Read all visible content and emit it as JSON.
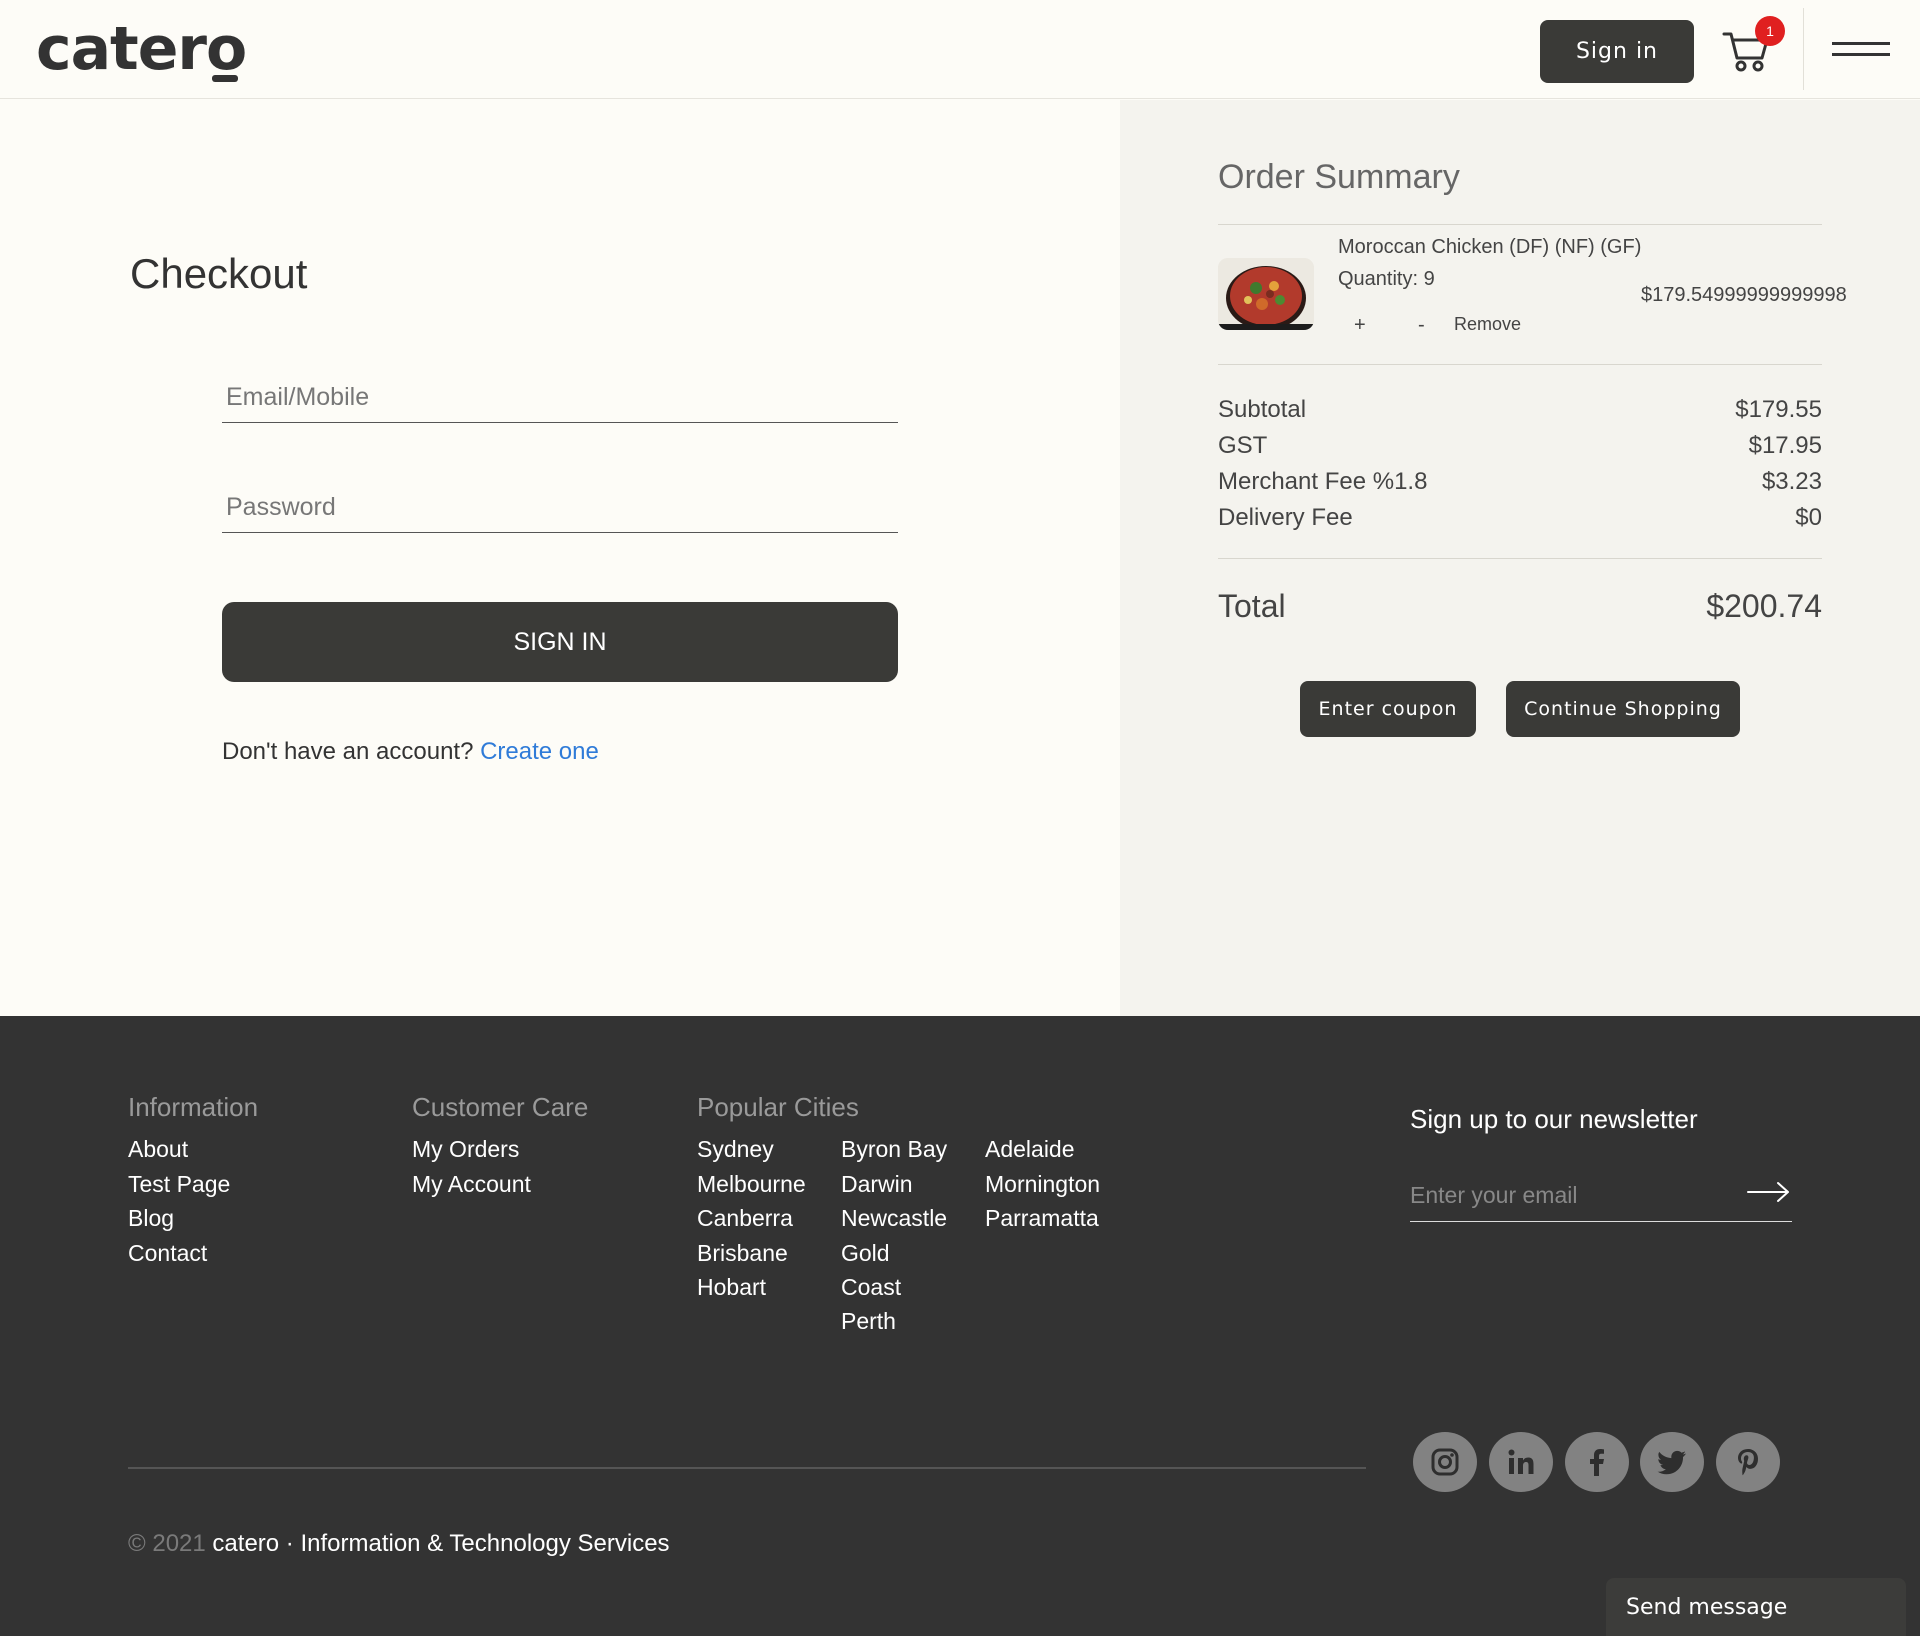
{
  "header": {
    "logo": "catero",
    "sign_in": "Sign in",
    "cart_count": "1",
    "cart_icon": "cart-icon",
    "menu_icon": "hamburger-menu-icon"
  },
  "checkout": {
    "title": "Checkout",
    "email_placeholder": "Email/Mobile",
    "password_placeholder": "Password",
    "sign_in_button": "SIGN IN",
    "no_account_text": "Don't have an account? ",
    "create_link": "Create one"
  },
  "summary": {
    "title": "Order Summary",
    "item": {
      "name": "Moroccan Chicken (DF) (NF) (GF)",
      "quantity": "Quantity: 9",
      "price": "$179.54999999999998",
      "plus": "+",
      "minus": "-",
      "remove": "Remove"
    },
    "rows": [
      {
        "label": "Subtotal",
        "value": "$179.55"
      },
      {
        "label": "GST",
        "value": "$17.95"
      },
      {
        "label": "Merchant Fee %1.8",
        "value": "$3.23"
      },
      {
        "label": "Delivery Fee",
        "value": "$0"
      }
    ],
    "total_label": "Total",
    "total_value": "$200.74",
    "coupon_button": "Enter coupon",
    "continue_button": "Continue Shopping"
  },
  "footer": {
    "information": {
      "title": "Information",
      "links": [
        "About",
        "Test Page",
        "Blog",
        "Contact"
      ]
    },
    "customer_care": {
      "title": "Customer Care",
      "links": [
        "My Orders",
        "My Account"
      ]
    },
    "cities": {
      "title": "Popular Cities",
      "col1": [
        "Sydney",
        "Melbourne",
        "Canberra",
        "Brisbane",
        "Hobart"
      ],
      "col2": [
        "Byron Bay",
        "Darwin",
        "Newcastle",
        "Gold",
        "Coast",
        "Perth"
      ],
      "col3": [
        "Adelaide",
        "Mornington",
        "Parramatta"
      ]
    },
    "newsletter": {
      "title": "Sign up to our newsletter",
      "placeholder": "Enter your email"
    },
    "social_icons": [
      "instagram-icon",
      "linkedin-icon",
      "facebook-icon",
      "twitter-icon",
      "pinterest-icon"
    ],
    "copyright_dim": "© 2021",
    "copyright_brand": "catero",
    "copyright_rest": "· Information & Technology Services",
    "send_message": "Send message"
  },
  "colors": {
    "background": "#fdfcf7",
    "panel": "#f4f3ee",
    "dark": "#333333",
    "button": "#3a3a37",
    "link": "#2f7bd8",
    "badge": "#e02020"
  }
}
